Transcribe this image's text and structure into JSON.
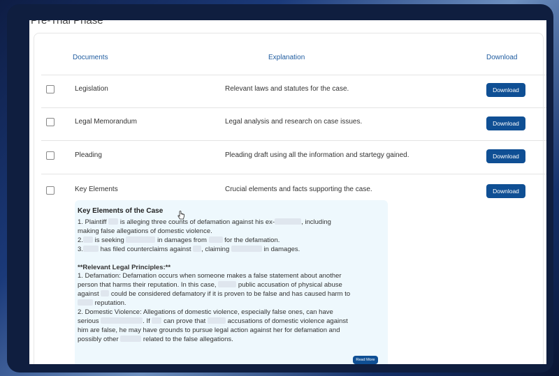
{
  "page": {
    "phase_title": "Pre-Trial Phase"
  },
  "table": {
    "headers": {
      "documents": "Documents",
      "explanation": "Explanation",
      "download": "Download"
    },
    "rows": [
      {
        "name": "Legislation",
        "explanation": "Relevant laws and statutes for the case.",
        "button": "Download"
      },
      {
        "name": "Legal Memorandum",
        "explanation": "Legal analysis and research on case issues.",
        "button": "Download"
      },
      {
        "name": "Pleading",
        "explanation": "Pleading draft using all the information and startegy gained.",
        "button": "Download"
      },
      {
        "name": "Key Elements",
        "explanation": "Crucial elements and facts supporting the case.",
        "button": "Download"
      }
    ]
  },
  "summary": {
    "title": "Key Elements of the Case",
    "l1a": "1. Plaintiff",
    "l1b": "is alleging three counts of defamation against his ex-",
    "l1c": ", including",
    "l2": "making false allegations of domestic violence.",
    "l3a": "2.",
    "l3b": "is seeking",
    "l3c": "in damages from",
    "l3d": "for the defamation.",
    "l4a": "3.",
    "l4b": "has filed counterclaims against",
    "l4c": ", claiming",
    "l4d": "in damages.",
    "principles_heading": "**Relevant Legal Principles:**",
    "p1a": "1. Defamation: Defamation occurs when someone makes a false statement about another",
    "p1b1": "person that harms their reputation. In this case,",
    "p1b2": "public accusation of physical abuse",
    "p1c1": "against",
    "p1c2": "could be considered defamatory if it is proven to be false and has caused harm to",
    "p1d": "reputation.",
    "p2a": "2. Domestic Violence: Allegations of domestic violence, especially false ones, can have",
    "p2b1": "serious",
    "p2b2": ". If",
    "p2b3": "can prove that",
    "p2b4": "accusations of domestic violence against",
    "p2c": "him are false, he may have grounds to pursue legal action against her for defamation and",
    "p2d1": "possibly other",
    "p2d2": "related to the false allegations.",
    "read_more": "Read More"
  }
}
